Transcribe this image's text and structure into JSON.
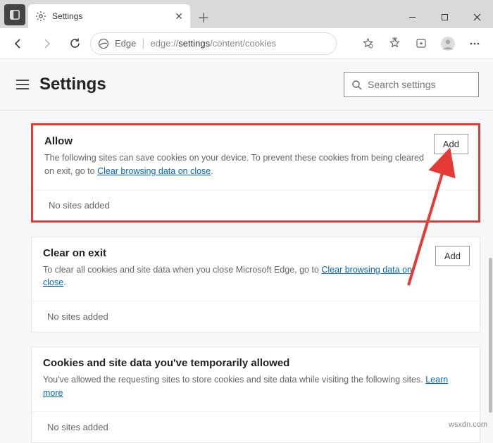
{
  "window": {
    "tab_title": "Settings"
  },
  "toolbar": {
    "edge_label": "Edge",
    "url_prefix": "edge://",
    "url_bold": "settings",
    "url_suffix": "/content/cookies"
  },
  "header": {
    "title": "Settings",
    "search_placeholder": "Search settings"
  },
  "sections": {
    "allow": {
      "title": "Allow",
      "desc_before": "The following sites can save cookies on your device. To prevent these cookies from being cleared on exit, go to ",
      "link": "Clear browsing data on close",
      "desc_after": ".",
      "add": "Add",
      "empty": "No sites added"
    },
    "clear": {
      "title": "Clear on exit",
      "desc_before": "To clear all cookies and site data when you close Microsoft Edge, go to ",
      "link": "Clear browsing data on close",
      "desc_after": ".",
      "add": "Add",
      "empty": "No sites added"
    },
    "temp": {
      "title": "Cookies and site data you've temporarily allowed",
      "desc_before": "You've allowed the requesting sites to store cookies and site data while visiting the following sites. ",
      "link": "Learn more",
      "empty": "No sites added"
    }
  },
  "watermark": "wsxdn.com"
}
